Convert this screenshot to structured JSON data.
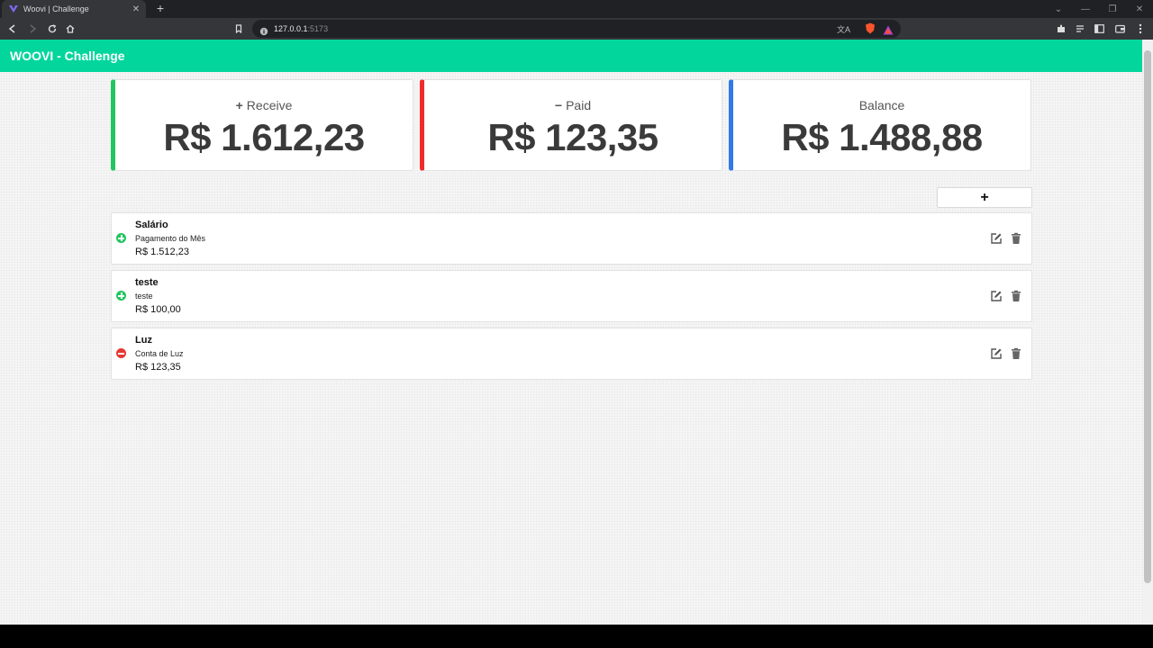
{
  "browser": {
    "tab_title": "Woovi | Challenge",
    "url_host": "127.0.0.1",
    "url_port": ":5173"
  },
  "app": {
    "title": "WOOVI - Challenge",
    "brand_color": "#03d69d"
  },
  "summary": [
    {
      "symbol": "+",
      "label": "Receive",
      "value": "R$ 1.612,23",
      "accent": "#22c55e"
    },
    {
      "symbol": "−",
      "label": "Paid",
      "value": "R$ 123,35",
      "accent": "#ef2b2b"
    },
    {
      "symbol": "",
      "label": "Balance",
      "value": "R$ 1.488,88",
      "accent": "#2f7ae5"
    }
  ],
  "add_button": {
    "label": "+"
  },
  "transactions": [
    {
      "title": "Salário",
      "description": "Pagamento do Mês",
      "amount": "R$ 1.512,23",
      "type": "income",
      "icon": "plus-circle-icon",
      "icon_color": "#22c55e"
    },
    {
      "title": "teste",
      "description": "teste",
      "amount": "R$ 100,00",
      "type": "income",
      "icon": "plus-circle-icon",
      "icon_color": "#22c55e"
    },
    {
      "title": "Luz",
      "description": "Conta de Luz",
      "amount": "R$ 123,35",
      "type": "expense",
      "icon": "minus-circle-icon",
      "icon_color": "#e53935"
    }
  ]
}
